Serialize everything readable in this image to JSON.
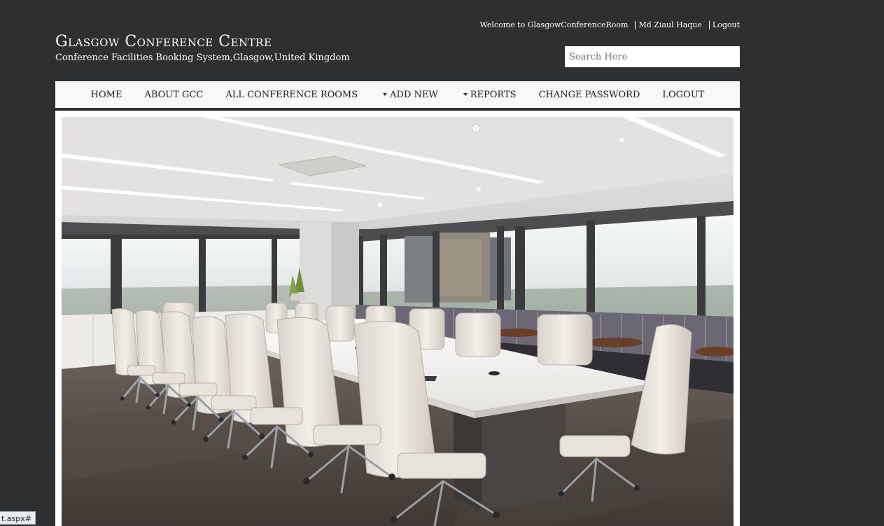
{
  "header": {
    "welcome_text": "Welcome to GlasgowConferenceRoom",
    "user_name": "Md Ziaul Haque",
    "logout_link": "Logout",
    "title": "Glasgow Conference Centre",
    "subtitle": "Conference Facilities Booking System,Glasgow,United Kingdom",
    "search_placeholder": "Search Here"
  },
  "nav": {
    "items": [
      {
        "label": "HOME"
      },
      {
        "label": "ABOUT GCC"
      },
      {
        "label": "ALL CONFERENCE ROOMS"
      },
      {
        "label": "ADD NEW"
      },
      {
        "label": "REPORTS"
      },
      {
        "label": "CHANGE PASSWORD"
      },
      {
        "label": "LOGOUT"
      }
    ]
  },
  "status_bar": {
    "url_text": "t.aspx#"
  },
  "colors": {
    "page_background": "#2d2f31",
    "nav_background": "#f8f8f8",
    "content_background": "#ffffff"
  }
}
